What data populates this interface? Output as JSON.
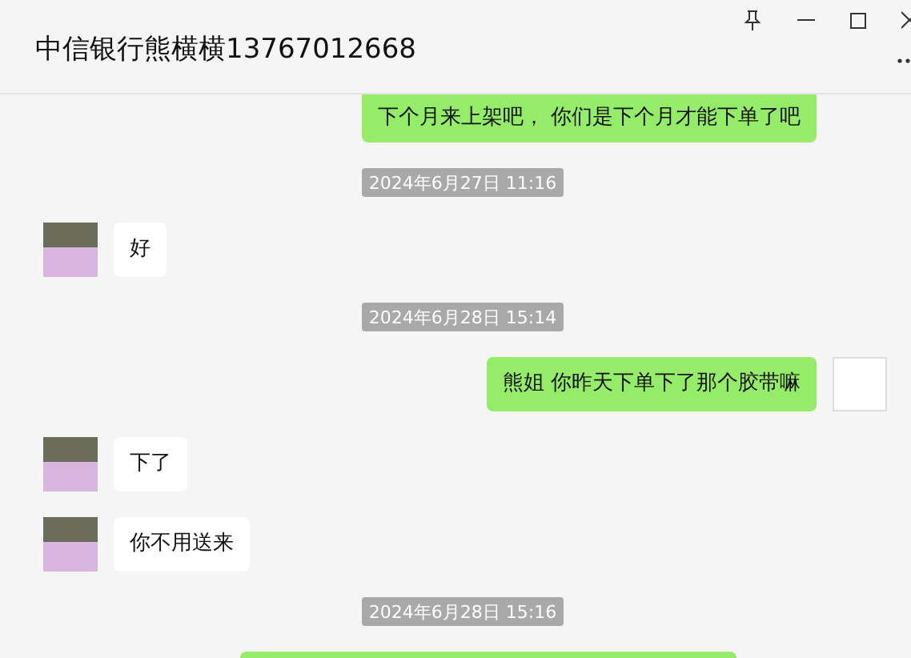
{
  "window": {
    "title": "中信银行熊横横13767012668"
  },
  "messages": [
    {
      "kind": "out",
      "text": "下个月来上架吧， 你们是下个月才能下单了吧",
      "cut": true
    },
    {
      "kind": "time",
      "text": "2024年6月27日 11:16"
    },
    {
      "kind": "in",
      "text": "好"
    },
    {
      "kind": "time",
      "text": "2024年6月28日 15:14"
    },
    {
      "kind": "out",
      "text": "熊姐 你昨天下单下了那个胶带嘛"
    },
    {
      "kind": "in",
      "text": "下了"
    },
    {
      "kind": "in",
      "text": "你不用送来"
    },
    {
      "kind": "time",
      "text": "2024年6月28日 15:16"
    }
  ]
}
